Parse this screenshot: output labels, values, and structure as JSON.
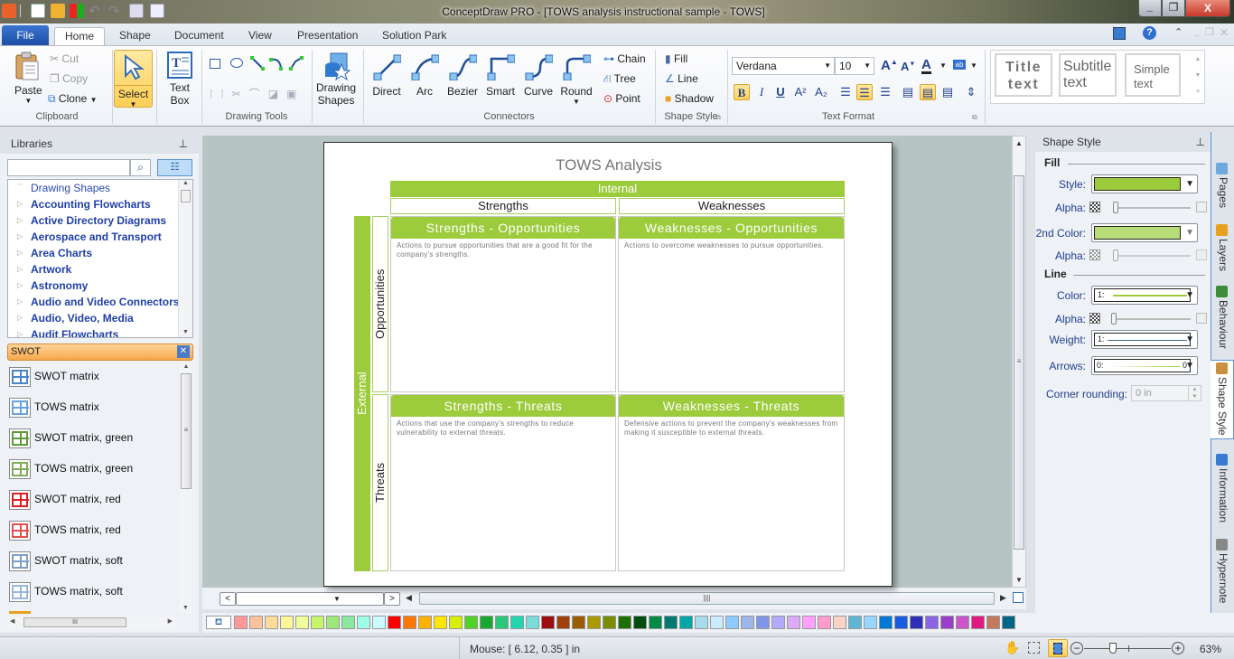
{
  "window": {
    "title": "ConceptDraw PRO - [TOWS analysis instructional sample - TOWS]",
    "controls": {
      "minimize": "_",
      "restore": "❐",
      "close": "X"
    }
  },
  "quick_access": [
    "app-icon",
    "new-doc-icon",
    "open-icon",
    "palette-icon",
    "undo-icon",
    "redo-icon",
    "save-icon",
    "print-preview-icon"
  ],
  "ribbon_tabs": {
    "file": "File",
    "tabs": [
      "Home",
      "Shape",
      "Document",
      "View",
      "Presentation",
      "Solution Park"
    ],
    "active": "Home"
  },
  "ribbon": {
    "clipboard": {
      "paste": "Paste",
      "cut": "Cut",
      "copy": "Copy",
      "clone": "Clone",
      "group": "Clipboard"
    },
    "select": {
      "label": "Select"
    },
    "text_box": {
      "line1": "Text",
      "line2": "Box"
    },
    "drawing_tools": {
      "group": "Drawing Tools"
    },
    "drawing_shapes": {
      "line1": "Drawing",
      "line2": "Shapes"
    },
    "connectors": {
      "items": [
        "Direct",
        "Arc",
        "Bezier",
        "Smart",
        "Curve",
        "Round"
      ],
      "chain": "Chain",
      "tree": "Tree",
      "point": "Point",
      "group": "Connectors"
    },
    "shape_style": {
      "fill": "Fill",
      "line": "Line",
      "shadow": "Shadow",
      "group": "Shape Style"
    },
    "text_format": {
      "font": "Verdana",
      "size": "10",
      "group": "Text Format"
    },
    "styles": {
      "title": "Title text",
      "subtitle": "Subtitle text",
      "simple": "Simple text"
    }
  },
  "libraries": {
    "header": "Libraries",
    "search_placeholder": "",
    "tree": [
      "Drawing Shapes",
      "Accounting Flowcharts",
      "Active Directory Diagrams",
      "Aerospace and Transport",
      "Area Charts",
      "Artwork",
      "Astronomy",
      "Audio and Video Connectors",
      "Audio, Video, Media",
      "Audit Flowcharts"
    ],
    "open_library": "SWOT",
    "shapes": [
      {
        "label": "SWOT matrix",
        "color": "#4a86c8"
      },
      {
        "label": "TOWS matrix",
        "color": "#6aa2dc"
      },
      {
        "label": "SWOT matrix, green",
        "color": "#5e9a3a"
      },
      {
        "label": "TOWS matrix, green",
        "color": "#7fae5a"
      },
      {
        "label": "SWOT matrix, red",
        "color": "#e02020"
      },
      {
        "label": "TOWS matrix, red",
        "color": "#e65050"
      },
      {
        "label": "SWOT matrix, soft",
        "color": "#7f9fc4"
      },
      {
        "label": "TOWS matrix, soft",
        "color": "#9bb6d8"
      }
    ]
  },
  "diagram": {
    "title": "TOWS Analysis",
    "internal": "Internal",
    "external": "External",
    "strengths": "Strengths",
    "weaknesses": "Weaknesses",
    "opportunities": "Opportunities",
    "threats": "Threats",
    "quadrants": [
      {
        "title": "Strengths - Opportunities",
        "desc": "Actions to pursue opportunities that are a good fit for the company's strengths."
      },
      {
        "title": "Weaknesses - Opportunities",
        "desc": "Actions to overcome weaknesses to pursue opportunities."
      },
      {
        "title": "Strengths - Threats",
        "desc": "Actions that use the company's strengths to reduce vulnerability to external threats."
      },
      {
        "title": "Weaknesses - Threats",
        "desc": "Defensive actions to prevent the company's weaknesses from making it susceptible to external threats."
      }
    ],
    "accent": "#9ccb3c"
  },
  "shape_style_panel": {
    "header": "Shape Style",
    "fill": "Fill",
    "style_label": "Style:",
    "style_color": "#9ccb3c",
    "alpha_label": "Alpha:",
    "second_color_label": "2nd Color:",
    "second_color": "#b8dc78",
    "line": "Line",
    "color_label": "Color:",
    "color_value": "1:",
    "weight_label": "Weight:",
    "weight_value": "1:",
    "arrows_label": "Arrows:",
    "arrows_value": "0:",
    "arrows_end": "0",
    "corner_label": "Corner rounding:",
    "corner_value": "0 in"
  },
  "side_tabs": [
    "Pages",
    "Layers",
    "Behaviour",
    "Shape Style",
    "Information",
    "Hypernote"
  ],
  "palette": [
    "#ff9999",
    "#ffc39b",
    "#ffdb99",
    "#fff599",
    "#f0ff99",
    "#c5f56a",
    "#9ee87a",
    "#8ae8a0",
    "#9effe8",
    "#ccfbff",
    "#ff0000",
    "#ff7700",
    "#ffb100",
    "#ffe600",
    "#d6f000",
    "#4fd126",
    "#1aa631",
    "#2ac67a",
    "#22d4b0",
    "#7adbdb",
    "#9c0c10",
    "#a0400b",
    "#9c5c06",
    "#a89a00",
    "#7a8c00",
    "#1e6e00",
    "#004d10",
    "#008a45",
    "#007a70",
    "#00a6a6",
    "#a6dcec",
    "#c9ecff",
    "#8ccaff",
    "#9cb5ea",
    "#8096e8",
    "#b3aaff",
    "#ddaaf5",
    "#ffa0ff",
    "#ff9ccc",
    "#fad3c6",
    "#5fb6d6",
    "#99d6ff",
    "#0078d4",
    "#1a5ce0",
    "#2e2eb8",
    "#8a66e6",
    "#9c3ecc",
    "#cc55cc",
    "#e01a80",
    "#c47a5c",
    "#006688"
  ],
  "status": {
    "mouse": "Mouse: [ 6.12, 0.35 ] in",
    "zoom": "63%",
    "zoom_fraction": 0.63
  }
}
